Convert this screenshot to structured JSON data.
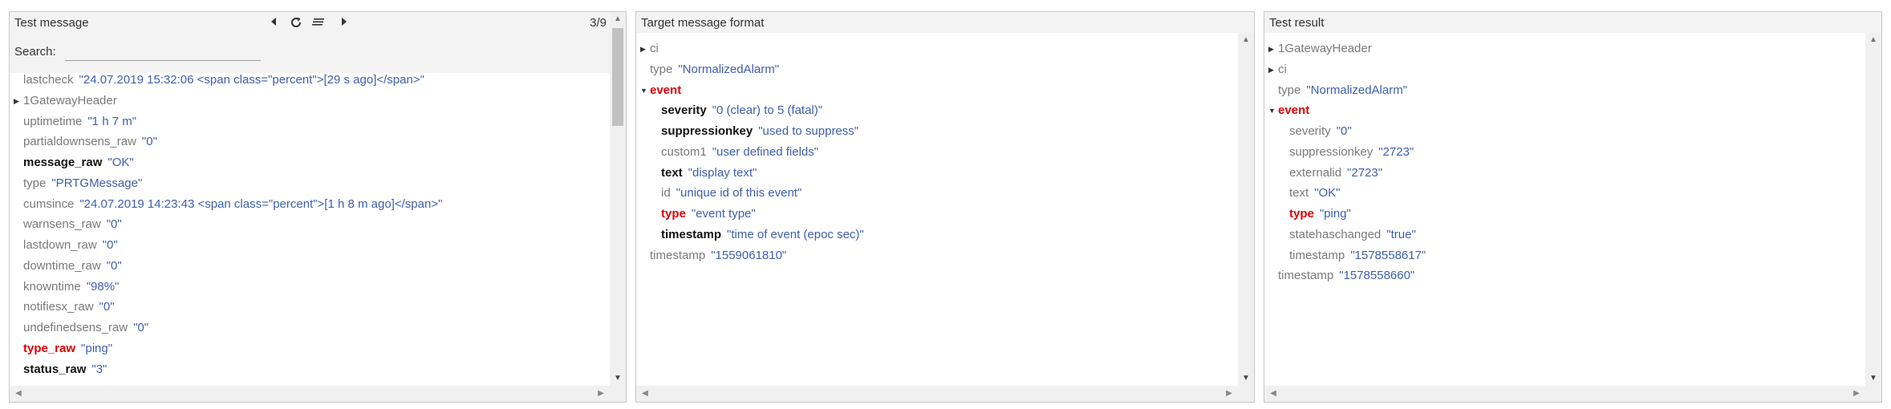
{
  "panels": {
    "test_message": {
      "title": "Test message",
      "counter": "3/9",
      "search_label": "Search:",
      "search_value": "",
      "toolbar_icons": [
        "prev-icon",
        "refresh-icon",
        "format-icon",
        "next-icon"
      ],
      "rows": [
        {
          "key": "lastcheck",
          "value": "\"24.07.2019 15:32:06 <span class=\"percent\">[29 s ago]</span>\"",
          "style": "normal"
        },
        {
          "key": "1GatewayHeader",
          "value": "",
          "style": "normal",
          "caret": "▶"
        },
        {
          "key": "uptimetime",
          "value": "\"1 h 7 m\"",
          "style": "normal"
        },
        {
          "key": "partialdownsens_raw",
          "value": "\"0\"",
          "style": "normal"
        },
        {
          "key": "message_raw",
          "value": "\"OK\"",
          "style": "bold"
        },
        {
          "key": "type",
          "value": "\"PRTGMessage\"",
          "style": "normal"
        },
        {
          "key": "cumsince",
          "value": "\"24.07.2019 14:23:43 <span class=\"percent\">[1 h 8 m ago]</span>\"",
          "style": "normal"
        },
        {
          "key": "warnsens_raw",
          "value": "\"0\"",
          "style": "normal"
        },
        {
          "key": "lastdown_raw",
          "value": "\"0\"",
          "style": "normal"
        },
        {
          "key": "downtime_raw",
          "value": "\"0\"",
          "style": "normal"
        },
        {
          "key": "knowntime",
          "value": "\"98%\"",
          "style": "normal"
        },
        {
          "key": "notifiesx_raw",
          "value": "\"0\"",
          "style": "normal"
        },
        {
          "key": "undefinedsens_raw",
          "value": "\"0\"",
          "style": "normal"
        },
        {
          "key": "type_raw",
          "value": "\"ping\"",
          "style": "red"
        },
        {
          "key": "status_raw",
          "value": "\"3\"",
          "style": "bold"
        }
      ]
    },
    "target_format": {
      "title": "Target message format",
      "rows": [
        {
          "key": "ci",
          "value": "",
          "style": "normal",
          "caret": "▶"
        },
        {
          "key": "type",
          "value": "\"NormalizedAlarm\"",
          "style": "normal"
        },
        {
          "key": "event",
          "value": "",
          "style": "red",
          "caret": "▼"
        },
        {
          "key": "severity",
          "value": "\"0 (clear) to 5 (fatal)\"",
          "style": "bold"
        },
        {
          "key": "suppressionkey",
          "value": "\"used to suppress\"",
          "style": "bold"
        },
        {
          "key": "custom1",
          "value": "\"user defined fields\"",
          "style": "normal"
        },
        {
          "key": "text",
          "value": "\"display text\"",
          "style": "bold"
        },
        {
          "key": "id",
          "value": "\"unique id of this event\"",
          "style": "normal"
        },
        {
          "key": "type",
          "value": "\"event type\"",
          "style": "red"
        },
        {
          "key": "timestamp",
          "value": "\"time of event (epoc sec)\"",
          "style": "bold"
        },
        {
          "key": "timestamp",
          "value": "\"1559061810\"",
          "style": "normal"
        }
      ]
    },
    "test_result": {
      "title": "Test result",
      "rows": [
        {
          "key": "1GatewayHeader",
          "value": "",
          "style": "normal",
          "caret": "▶"
        },
        {
          "key": "ci",
          "value": "",
          "style": "normal",
          "caret": "▶"
        },
        {
          "key": "type",
          "value": "\"NormalizedAlarm\"",
          "style": "normal"
        },
        {
          "key": "event",
          "value": "",
          "style": "red",
          "caret": "▼"
        },
        {
          "key": "severity",
          "value": "\"0\"",
          "style": "normal"
        },
        {
          "key": "suppressionkey",
          "value": "\"2723\"",
          "style": "normal"
        },
        {
          "key": "externalid",
          "value": "\"2723\"",
          "style": "normal"
        },
        {
          "key": "text",
          "value": "\"OK\"",
          "style": "normal"
        },
        {
          "key": "type",
          "value": "\"ping\"",
          "style": "red"
        },
        {
          "key": "statehaschanged",
          "value": "\"true\"",
          "style": "normal"
        },
        {
          "key": "timestamp",
          "value": "\"1578558617\"",
          "style": "normal"
        },
        {
          "key": "timestamp",
          "value": "\"1578558660\"",
          "style": "normal"
        }
      ]
    }
  },
  "colors": {
    "key": "#7a7a7a",
    "key_bold": "#111111",
    "key_red": "#e00000",
    "value": "#3f5fae",
    "panel_bg": "#f3f3f3",
    "scrollbar": "#f0f0f0",
    "thumb": "#c1c1c1"
  }
}
